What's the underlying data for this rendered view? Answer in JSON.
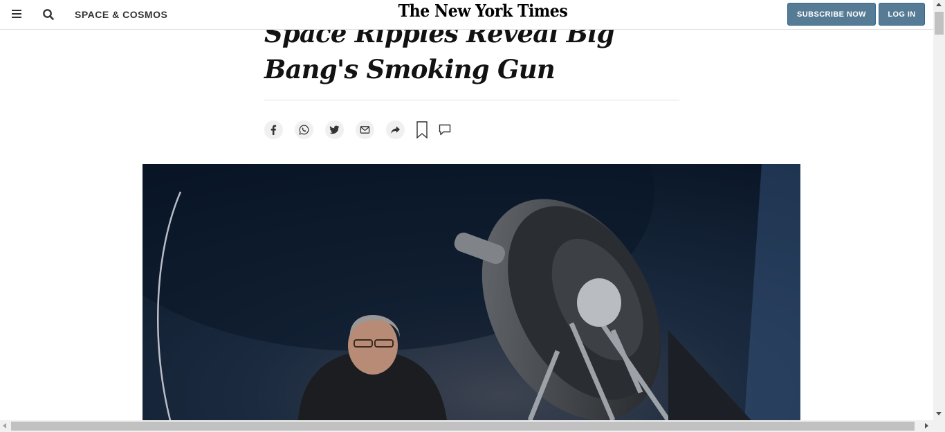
{
  "header": {
    "section": "SPACE & COSMOS",
    "logo_text": "The New York Times",
    "subscribe_label": "SUBSCRIBE NOW",
    "login_label": "LOG IN"
  },
  "article": {
    "headline": "Space Ripples Reveal Big Bang's Smoking Gun"
  },
  "share_tools": [
    {
      "name": "facebook-icon"
    },
    {
      "name": "whatsapp-icon"
    },
    {
      "name": "twitter-icon"
    },
    {
      "name": "email-icon"
    },
    {
      "name": "share-arrow-icon"
    },
    {
      "name": "bookmark-icon"
    },
    {
      "name": "comment-icon"
    }
  ],
  "colors": {
    "button_bg": "#567b95",
    "text": "#121212",
    "divider": "#e2e2e2",
    "share_bg": "#f0f0f0"
  }
}
